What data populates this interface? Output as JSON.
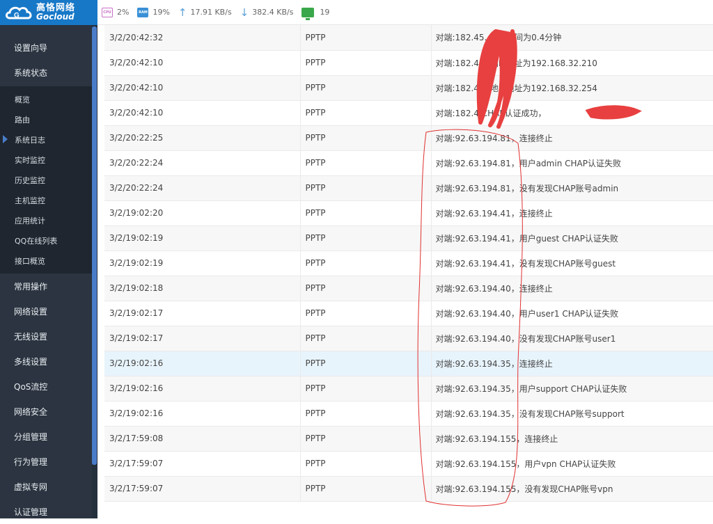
{
  "brand": {
    "name_cn": "高恪网络",
    "name_en": "Gocloud"
  },
  "stats": {
    "cpu_label": "CPU",
    "cpu": "2%",
    "ram_label": "RAM",
    "ram": "19%",
    "upload": "17.91 KB/s",
    "download": "382.4 KB/s",
    "online_hosts": "19"
  },
  "sidebar": {
    "top": [
      "设置向导",
      "系统状态"
    ],
    "sub": [
      "概览",
      "路由",
      "系统日志",
      "实时监控",
      "历史监控",
      "主机监控",
      "应用统计",
      "QQ在线列表",
      "接口概览"
    ],
    "active_sub": "系统日志",
    "bottom": [
      "常用操作",
      "网络设置",
      "无线设置",
      "多线设置",
      "QoS流控",
      "网络安全",
      "分组管理",
      "行为管理",
      "虚拟专网",
      "认证管理"
    ]
  },
  "logs": [
    {
      "time": "3/2/20:42:32",
      "proto": "PPTP",
      "msg": "对端:182.45.        接入时间为0.4分钟"
    },
    {
      "time": "3/2/20:42:10",
      "proto": "PPTP",
      "msg": "对端:182.4          对端IP地址为192.168.32.210"
    },
    {
      "time": "3/2/20:42:10",
      "proto": "PPTP",
      "msg": "对端:182.4          本地IP地址为192.168.32.254"
    },
    {
      "time": "3/2/20:42:10",
      "proto": "PPTP",
      "msg": "对端:182.4          CHAP认证成功，"
    },
    {
      "time": "3/2/20:22:25",
      "proto": "PPTP",
      "msg": "对端:92.63.194.81，连接终止"
    },
    {
      "time": "3/2/20:22:24",
      "proto": "PPTP",
      "msg": "对端:92.63.194.81，用户admin CHAP认证失败"
    },
    {
      "time": "3/2/20:22:24",
      "proto": "PPTP",
      "msg": "对端:92.63.194.81，没有发现CHAP账号admin"
    },
    {
      "time": "3/2/19:02:20",
      "proto": "PPTP",
      "msg": "对端:92.63.194.41，连接终止"
    },
    {
      "time": "3/2/19:02:19",
      "proto": "PPTP",
      "msg": "对端:92.63.194.41，用户guest CHAP认证失败"
    },
    {
      "time": "3/2/19:02:19",
      "proto": "PPTP",
      "msg": "对端:92.63.194.41，没有发现CHAP账号guest"
    },
    {
      "time": "3/2/19:02:18",
      "proto": "PPTP",
      "msg": "对端:92.63.194.40，连接终止"
    },
    {
      "time": "3/2/19:02:17",
      "proto": "PPTP",
      "msg": "对端:92.63.194.40，用户user1 CHAP认证失败"
    },
    {
      "time": "3/2/19:02:17",
      "proto": "PPTP",
      "msg": "对端:92.63.194.40，没有发现CHAP账号user1"
    },
    {
      "time": "3/2/19:02:16",
      "proto": "PPTP",
      "msg": "对端:92.63.194.35，连接终止",
      "highlight": true
    },
    {
      "time": "3/2/19:02:16",
      "proto": "PPTP",
      "msg": "对端:92.63.194.35，用户support CHAP认证失败"
    },
    {
      "time": "3/2/19:02:16",
      "proto": "PPTP",
      "msg": "对端:92.63.194.35，没有发现CHAP账号support"
    },
    {
      "time": "3/2/17:59:08",
      "proto": "PPTP",
      "msg": "对端:92.63.194.155，连接终止"
    },
    {
      "time": "3/2/17:59:07",
      "proto": "PPTP",
      "msg": "对端:92.63.194.155，用户vpn CHAP认证失败"
    },
    {
      "time": "3/2/17:59:07",
      "proto": "PPTP",
      "msg": "对端:92.63.194.155，没有发现CHAP账号vpn"
    }
  ],
  "colors": {
    "sidebar": "#2b3440",
    "submenu": "#1f262f",
    "brand": "#1778c8",
    "annotation": "#e03030"
  }
}
